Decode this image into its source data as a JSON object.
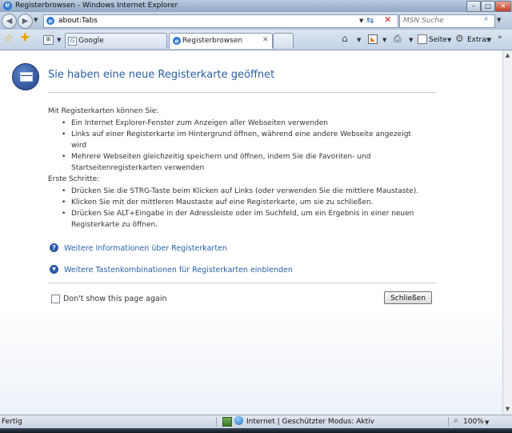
{
  "window": {
    "title": "Registerbrowsen - Windows Internet Explorer",
    "minimize_glyph": "–",
    "maximize_glyph": "□",
    "close_glyph": "✕"
  },
  "address_bar": {
    "url": "about:Tabs",
    "search_placeholder": "MSN Suche"
  },
  "tabs": [
    {
      "label": "Google",
      "active": false
    },
    {
      "label": "Registerbrowsen",
      "active": true
    }
  ],
  "command_bar": {
    "page_label": "Seite",
    "tools_label": "Extras"
  },
  "page": {
    "heading": "Sie haben eine neue Registerkarte geöffnet",
    "section1_intro": "Mit Registerkarten können Sie:",
    "section1_items": [
      "Ein Internet Explorer-Fenster zum Anzeigen aller Webseiten verwenden",
      "Links auf einer Registerkarte im Hintergrund öffnen, während eine andere Webseite angezeigt wird",
      "Mehrere Webseiten gleichzeitig speichern und öffnen, indem Sie die Favoriten- und Startseitenregisterkarten verwenden"
    ],
    "section2_intro": "Erste Schritte:",
    "section2_items": [
      "Drücken Sie die STRG-Taste beim Klicken auf Links (oder verwenden Sie die mittlere Maustaste).",
      "Klicken Sie mit der mittleren Maustaste auf eine Registerkarte, um sie zu schließen.",
      "Drücken Sie ALT+Eingabe in der Adressleiste oder im Suchfeld, um ein Ergebnis in einer neuen Registerkarte zu öffnen."
    ],
    "link_more_info": "Weitere Informationen über Registerkarten",
    "link_shortcuts": "Weitere Tastenkombinationen für Registerkarten einblenden",
    "checkbox_label": "Don't show this page again",
    "checkbox_checked": false,
    "close_button": "Schließen"
  },
  "status_bar": {
    "status": "Fertig",
    "zone": "Internet | Geschützter Modus: Aktiv",
    "zoom": "100%"
  },
  "colors": {
    "heading": "#2a5fa6",
    "link": "#2a5fa6",
    "icon_blue": "#2d58a8"
  }
}
